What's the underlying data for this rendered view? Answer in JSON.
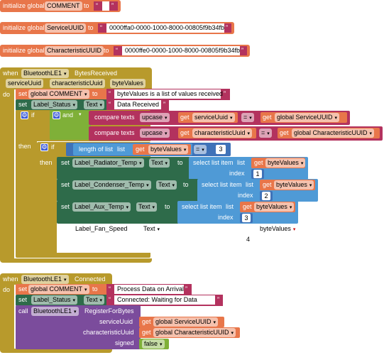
{
  "colors": {
    "variables": "#e8764a",
    "text": "#b3325e",
    "event": "#b89a2c",
    "component_set": "#2e6b4a",
    "control": "#b89a2c",
    "logic": "#7fb038",
    "lists": "#4f9ad6",
    "math": "#3f72b8",
    "method": "#7b4c9c"
  },
  "globals": [
    {
      "prefix": "initialize global",
      "name": "COMMENT",
      "to": "to",
      "value": ""
    },
    {
      "prefix": "initialize global",
      "name": "ServiceUUID",
      "to": "to",
      "value": "0000ffa0-0000-1000-8000-00805f9b34fb"
    },
    {
      "prefix": "initialize global",
      "name": "CharacteristicUUID",
      "to": "to",
      "value": "0000ffe0-0000-1000-8000-00805f9b34fb"
    }
  ],
  "event1": {
    "when": "when",
    "component": "BluetoothLE1",
    "event": "BytesReceived",
    "params": [
      "serviceUuid",
      "characteristicUuid",
      "byteValues"
    ],
    "do": "do",
    "set_comment": {
      "set": "set",
      "var": "global COMMENT",
      "to": "to",
      "value": "byteValues is a list of values received"
    },
    "set_status": {
      "set": "set",
      "component": "Label_Status",
      "prop": "Text",
      "to": "to",
      "value": "Data Received"
    },
    "if": {
      "if": "if",
      "and": "and",
      "cmp1": {
        "label": "compare texts",
        "op1": "upcase",
        "get": "get",
        "var": "serviceUuid",
        "eq": "=",
        "get2": "get",
        "var2": "global ServiceUUID"
      },
      "cmp2": {
        "label": "compare texts",
        "op1": "upcase",
        "get": "get",
        "var": "characteristicUuid",
        "eq": "=",
        "get2": "get",
        "var2": "global CharacteristicUUID"
      }
    },
    "then": "then",
    "inner_if": {
      "if": "if",
      "len": "length of list",
      "list": "list",
      "get": "get",
      "var": "byteValues",
      "eq": "=",
      "num": "3"
    },
    "inner_then": "then",
    "rows": [
      {
        "set": "set",
        "component": "Label_Radiator_Temp",
        "prop": "Text",
        "to": "to",
        "select": "select list item",
        "list": "list",
        "get": "get",
        "var": "byteValues",
        "index": "index",
        "num": "1"
      },
      {
        "set": "set",
        "component": "Label_Condenser_Temp",
        "prop": "Text",
        "to": "to",
        "select": "select list item",
        "list": "list",
        "get": "get",
        "var": "byteValues",
        "index": "index",
        "num": "2"
      },
      {
        "set": "set",
        "component": "Label_Aux_Temp",
        "prop": "Text",
        "to": "to",
        "select": "select list item",
        "list": "list",
        "get": "get",
        "var": "byteValues",
        "index": "index",
        "num": "3"
      }
    ],
    "disabled_row": {
      "component": "Label_Fan_Speed",
      "prop": "Text",
      "var": "byteValues",
      "num": "4"
    }
  },
  "event2": {
    "when": "when",
    "component": "BluetoothLE1",
    "event": "Connected",
    "do": "do",
    "set_comment": {
      "set": "set",
      "var": "global COMMENT",
      "to": "to",
      "value": "Process Data on Arrival"
    },
    "set_status": {
      "set": "set",
      "component": "Label_Status",
      "prop": "Text",
      "to": "to",
      "value": "Connected: Waiting for Data"
    },
    "call": {
      "call": "call",
      "component": "BluetoothLE1",
      "method": "RegisterForBytes",
      "args": [
        {
          "name": "serviceUuid",
          "get": "get",
          "var": "global ServiceUUID"
        },
        {
          "name": "characteristicUuid",
          "get": "get",
          "var": "global CharacteristicUUID"
        },
        {
          "name": "signed",
          "value": "false"
        }
      ]
    }
  }
}
